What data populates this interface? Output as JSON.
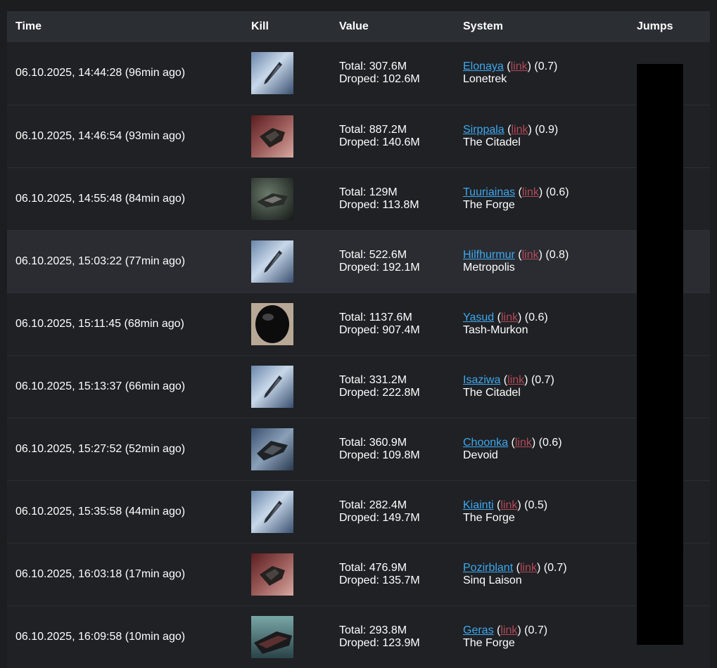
{
  "headers": {
    "time": "Time",
    "kill": "Kill",
    "value": "Value",
    "system": "System",
    "jumps": "Jumps"
  },
  "rows": [
    {
      "time": "06.10.2025, 14:44:28 (96min ago)",
      "ship_icon": "frigate-icon",
      "total": "Total: 307.6M",
      "dropped": "Droped: 102.6M",
      "system": "Elonaya",
      "link": "link",
      "security": "(0.7)",
      "region": "Lonetrek"
    },
    {
      "time": "06.10.2025, 14:46:54 (93min ago)",
      "ship_icon": "cruiser-icon",
      "total": "Total: 887.2M",
      "dropped": "Droped: 140.6M",
      "system": "Sirppala",
      "link": "link",
      "security": "(0.9)",
      "region": "The Citadel"
    },
    {
      "time": "06.10.2025, 14:55:48 (84min ago)",
      "ship_icon": "destroyer-icon",
      "total": "Total: 129M",
      "dropped": "Droped: 113.8M",
      "system": "Tuuriainas",
      "link": "link",
      "security": "(0.6)",
      "region": "The Forge"
    },
    {
      "time": "06.10.2025, 15:03:22 (77min ago)",
      "ship_icon": "frigate-icon",
      "total": "Total: 522.6M",
      "dropped": "Droped: 192.1M",
      "system": "Hilfhurmur",
      "link": "link",
      "security": "(0.8)",
      "region": "Metropolis"
    },
    {
      "time": "06.10.2025, 15:11:45 (68min ago)",
      "ship_icon": "pod-icon",
      "total": "Total: 1137.6M",
      "dropped": "Droped: 907.4M",
      "system": "Yasud",
      "link": "link",
      "security": "(0.6)",
      "region": "Tash-Murkon"
    },
    {
      "time": "06.10.2025, 15:13:37 (66min ago)",
      "ship_icon": "frigate-icon",
      "total": "Total: 331.2M",
      "dropped": "Droped: 222.8M",
      "system": "Isaziwa",
      "link": "link",
      "security": "(0.7)",
      "region": "The Citadel"
    },
    {
      "time": "06.10.2025, 15:27:52 (52min ago)",
      "ship_icon": "battlecruiser-icon",
      "total": "Total: 360.9M",
      "dropped": "Droped: 109.8M",
      "system": "Choonka",
      "link": "link",
      "security": "(0.6)",
      "region": "Devoid"
    },
    {
      "time": "06.10.2025, 15:35:58 (44min ago)",
      "ship_icon": "frigate-icon",
      "total": "Total: 282.4M",
      "dropped": "Droped: 149.7M",
      "system": "Kiainti",
      "link": "link",
      "security": "(0.5)",
      "region": "The Forge"
    },
    {
      "time": "06.10.2025, 16:03:18 (17min ago)",
      "ship_icon": "cruiser-icon",
      "total": "Total: 476.9M",
      "dropped": "Droped: 135.7M",
      "system": "Pozirblant",
      "link": "link",
      "security": "(0.7)",
      "region": "Sinq Laison"
    },
    {
      "time": "06.10.2025, 16:09:58 (10min ago)",
      "ship_icon": "industrial-icon",
      "total": "Total: 293.8M",
      "dropped": "Droped: 123.9M",
      "system": "Geras",
      "link": "link",
      "security": "(0.7)",
      "region": "The Forge"
    }
  ],
  "colors": {
    "system_link": "#3ea8f0",
    "ext_link": "#b34a5a",
    "header_bg": "#2b2e33",
    "row_bg": "#1f2124",
    "highlight_bg": "#2a2c31"
  }
}
